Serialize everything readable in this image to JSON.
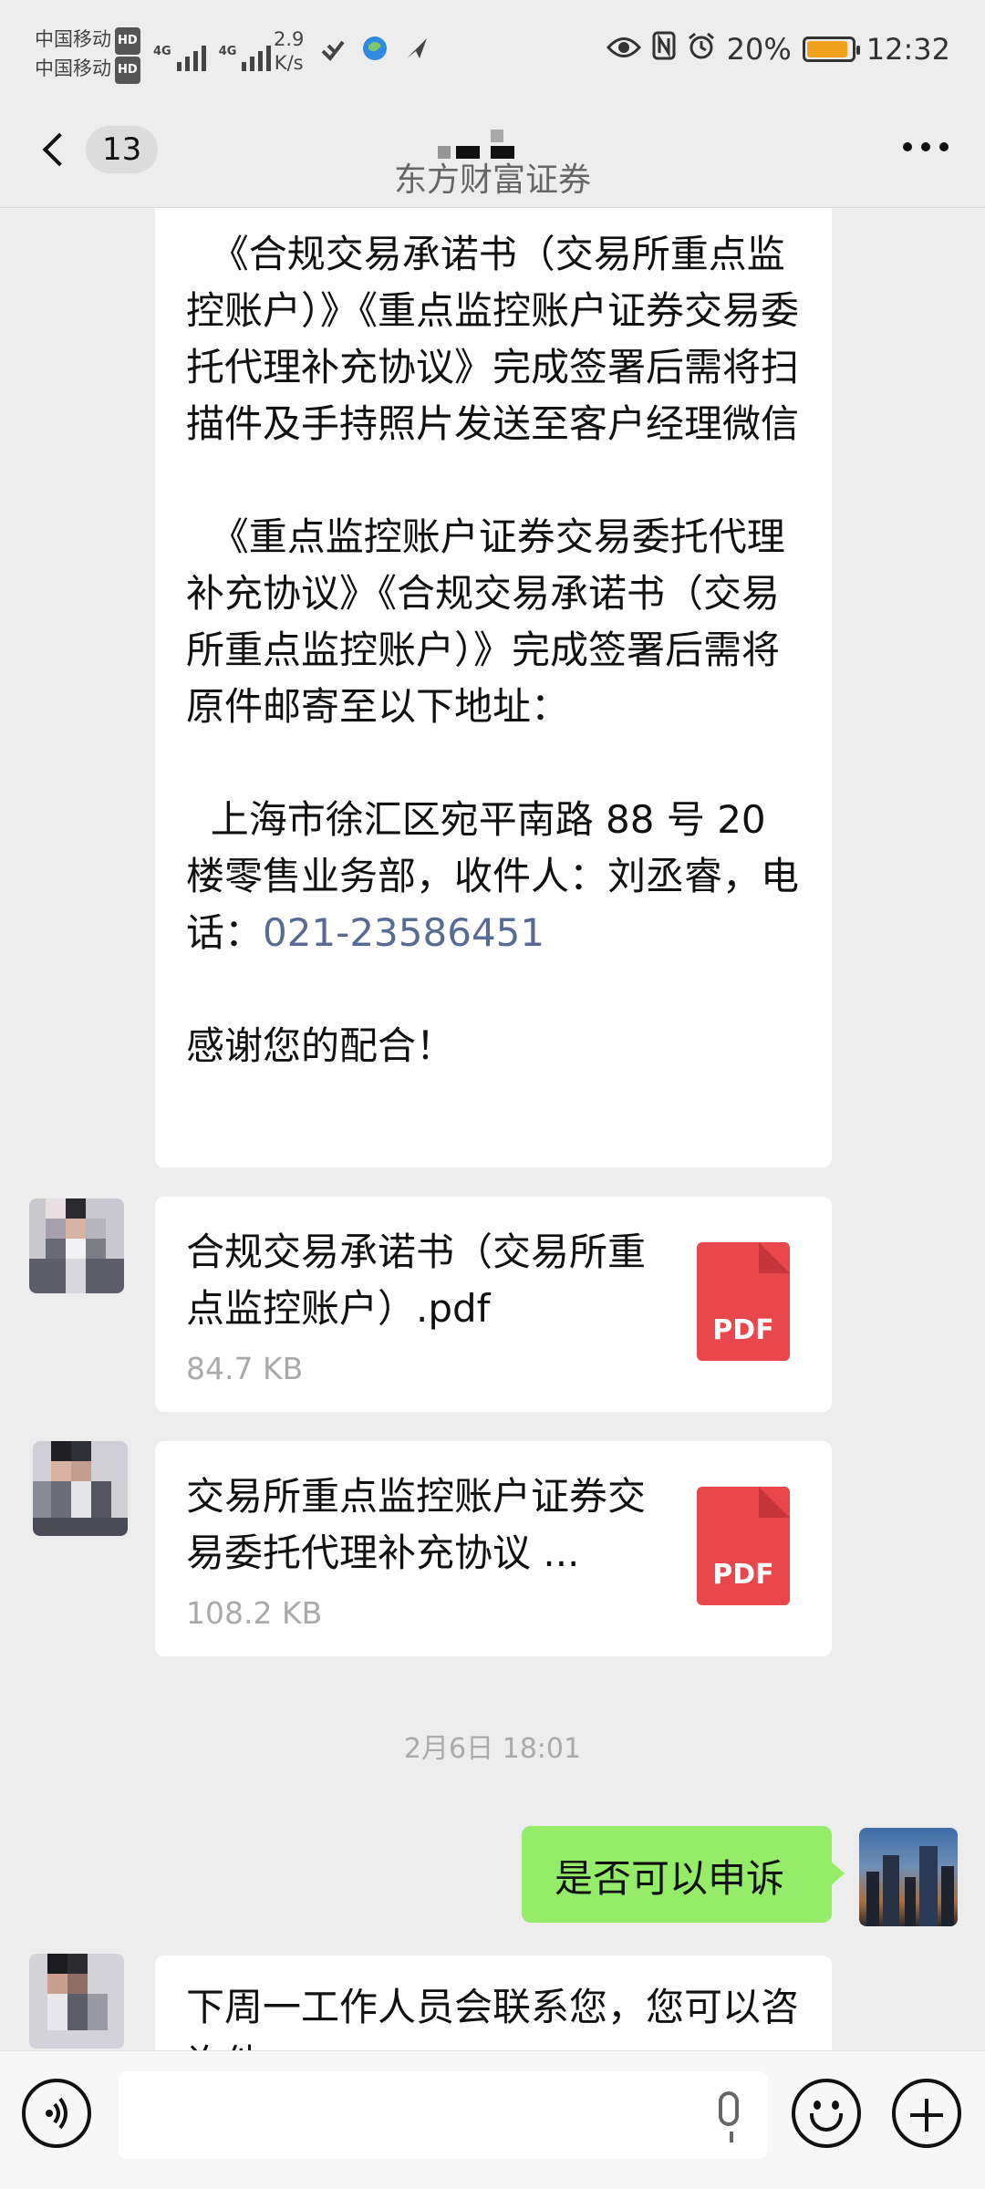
{
  "status_bar": {
    "carrier_1": "中国移动",
    "carrier_2": "中国移动",
    "hd_label": "HD",
    "network_1": "4G",
    "network_2": "4G",
    "speed_value": "2.9",
    "speed_unit": "K/s",
    "battery_percent": "20%",
    "time": "12:32"
  },
  "header": {
    "back_count": "13",
    "subtitle": "东方财富证券"
  },
  "messages": {
    "long_text": {
      "para1": "  《合规交易承诺书（交易所重点监控账户）》《重点监控账户证券交易委托代理补充协议》完成签署后需将扫描件及手持照片发送至客户经理微信",
      "para2": "  《重点监控账户证券交易委托代理补充协议》《合规交易承诺书（交易所重点监控账户）》完成签署后需将原件邮寄至以下地址：",
      "para3_prefix": "  上海市徐汇区宛平南路 88 号 20 楼零售业务部，收件人：刘丞睿，电话：",
      "phone": "021-23586451",
      "para4": "感谢您的配合！"
    },
    "file1": {
      "name": "合规交易承诺书（交易所重点监控账户）.pdf",
      "size": "84.7 KB",
      "icon_label": "PDF"
    },
    "file2": {
      "name": "交易所重点监控账户证券交易委托代理补充协议 ...",
      "size": "108.2 KB",
      "icon_label": "PDF"
    },
    "timestamp": "2月6日 18:01",
    "self_message": "是否可以申诉",
    "last_message": "下周一工作人员会联系您，您可以咨询他"
  },
  "colors": {
    "background": "#ededed",
    "self_bubble": "#95ec69",
    "link": "#576b95",
    "pdf": "#e9474b"
  }
}
